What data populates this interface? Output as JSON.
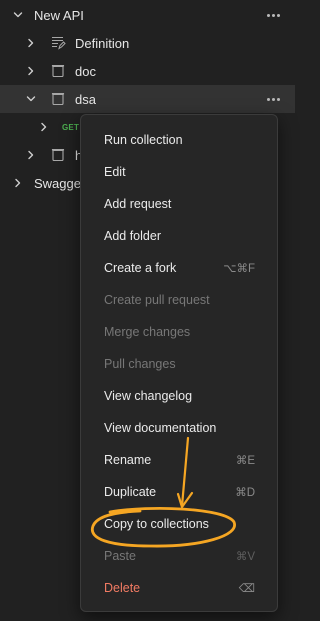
{
  "tree": {
    "root": {
      "label": "New API"
    },
    "items": [
      {
        "label": "Definition"
      },
      {
        "label": "doc"
      },
      {
        "label": "dsa"
      },
      {
        "method": "GET"
      },
      {
        "label": "h"
      }
    ],
    "second_root": {
      "label": "Swagge"
    }
  },
  "context_menu": {
    "items": [
      {
        "label": "Run collection",
        "shortcut": "",
        "state": "enabled"
      },
      {
        "label": "Edit",
        "shortcut": "",
        "state": "enabled"
      },
      {
        "label": "Add request",
        "shortcut": "",
        "state": "enabled"
      },
      {
        "label": "Add folder",
        "shortcut": "",
        "state": "enabled"
      },
      {
        "label": "Create a fork",
        "shortcut": "⌥⌘F",
        "state": "enabled"
      },
      {
        "label": "Create pull request",
        "shortcut": "",
        "state": "disabled"
      },
      {
        "label": "Merge changes",
        "shortcut": "",
        "state": "disabled"
      },
      {
        "label": "Pull changes",
        "shortcut": "",
        "state": "disabled"
      },
      {
        "label": "View changelog",
        "shortcut": "",
        "state": "enabled"
      },
      {
        "label": "View documentation",
        "shortcut": "",
        "state": "enabled"
      },
      {
        "label": "Rename",
        "shortcut": "⌘E",
        "state": "enabled"
      },
      {
        "label": "Duplicate",
        "shortcut": "⌘D",
        "state": "enabled"
      },
      {
        "label": "Copy to collections",
        "shortcut": "",
        "state": "enabled"
      },
      {
        "label": "Paste",
        "shortcut": "⌘V",
        "state": "disabled"
      },
      {
        "label": "Delete",
        "shortcut": "⌫",
        "state": "danger"
      }
    ]
  },
  "colors": {
    "background": "#212121",
    "menu_background": "#262626",
    "annotation": "#f5a623",
    "danger": "#f27b63",
    "get_method": "#4caf50"
  },
  "icons": {
    "expanded": "chevron-down-icon",
    "collapsed": "chevron-right-icon",
    "definition": "definition-icon",
    "folder": "folder-icon",
    "more": "more-options-icon",
    "delete_shortcut": "backspace-icon"
  }
}
